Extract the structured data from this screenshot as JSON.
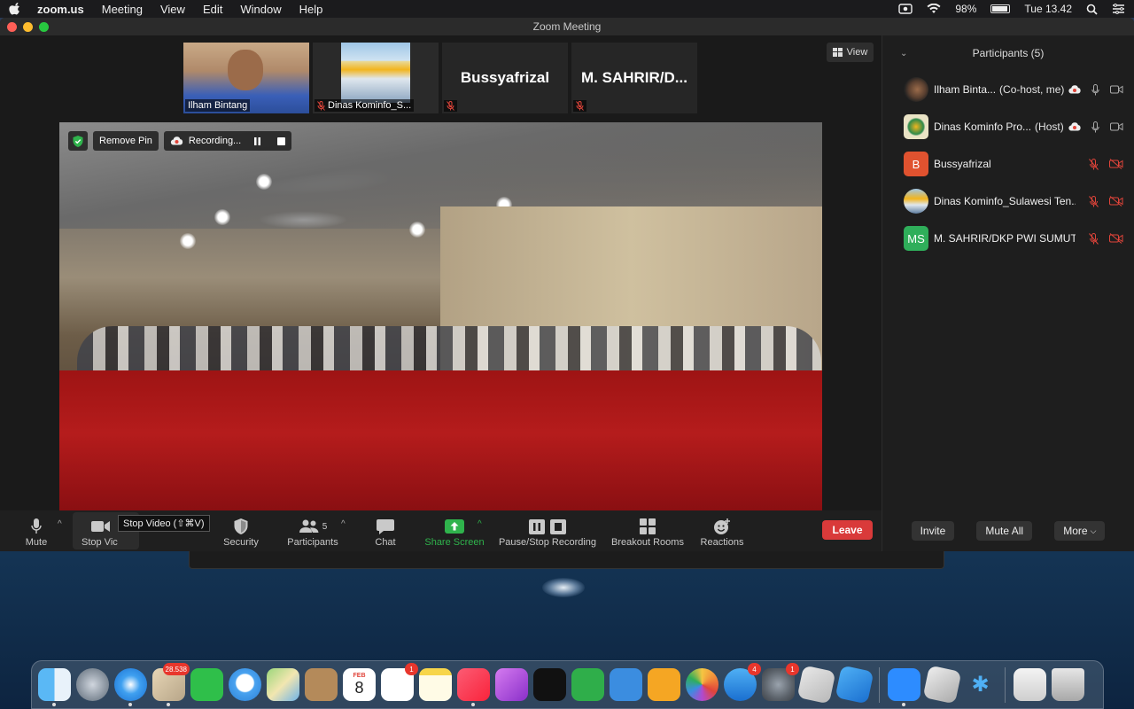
{
  "menubar": {
    "app_name": "zoom.us",
    "items": [
      "Meeting",
      "View",
      "Edit",
      "Window",
      "Help"
    ],
    "battery": "98%",
    "clock": "Tue 13.42"
  },
  "window": {
    "title": "Zoom Meeting"
  },
  "thumbnails": [
    {
      "name": "Ilham Bintang",
      "label": "",
      "muted": false
    },
    {
      "name": "Dinas Kominfo_S...",
      "label": "",
      "muted": true
    },
    {
      "name": "",
      "label": "Bussyafrizal",
      "muted": true
    },
    {
      "name": "",
      "label": "M. SAHRIR/D...",
      "muted": true
    }
  ],
  "view_button": "View",
  "video_controls": {
    "remove_pin": "Remove Pin",
    "recording": "Recording..."
  },
  "toolbar": {
    "mute": "Mute",
    "stop_video": "Stop Vic",
    "security": "Security",
    "participants": "Participants",
    "participants_count": "5",
    "chat": "Chat",
    "share_screen": "Share Screen",
    "pause_stop_recording": "Pause/Stop Recording",
    "breakout_rooms": "Breakout Rooms",
    "reactions": "Reactions",
    "leave": "Leave",
    "tooltip": "Stop Video (⇧⌘V)"
  },
  "panel": {
    "title": "Participants (5)",
    "participants": [
      {
        "name": "Ilham Binta...",
        "role": "(Co-host, me)",
        "avatar": "",
        "avatar_color": "#3a3a3a"
      },
      {
        "name": "Dinas Kominfo Pro...",
        "role": "(Host)",
        "avatar": "",
        "avatar_color": "#e9e3c5"
      },
      {
        "name": "Bussyafrizal",
        "role": "",
        "avatar": "B",
        "avatar_color": "#e0522f"
      },
      {
        "name": "Dinas Kominfo_Sulawesi Ten...",
        "role": "",
        "avatar": "",
        "avatar_color": "#8fb6d6"
      },
      {
        "name": "M. SAHRIR/DKP PWI SUMUT",
        "role": "",
        "avatar": "MS",
        "avatar_color": "#2fae5a"
      }
    ],
    "invite": "Invite",
    "mute_all": "Mute All",
    "more": "More"
  },
  "dock": {
    "badges": {
      "mail": "28.538",
      "calendar_day": "8",
      "calendar_month": "FEB",
      "reminders": "1",
      "app_store": "4",
      "system_prefs": "1"
    }
  },
  "colors": {
    "accent_green": "#2fb34c",
    "leave_red": "#d93a3a",
    "muted_red": "#e0443a"
  }
}
